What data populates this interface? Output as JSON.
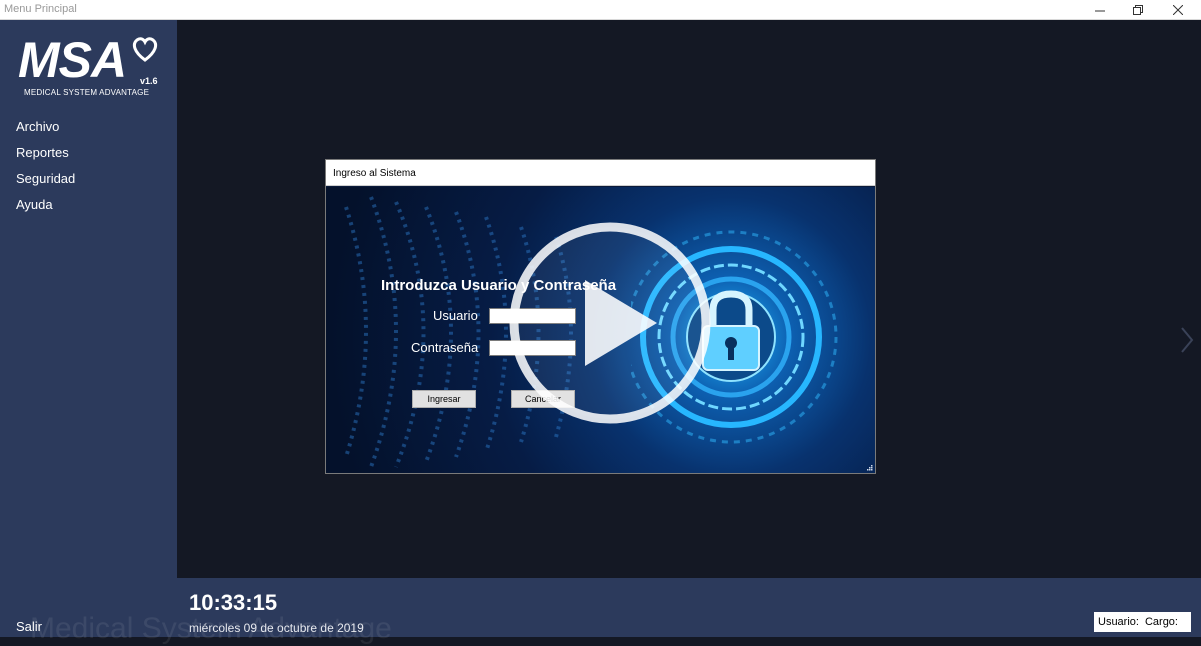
{
  "window": {
    "title": "Menu Principal"
  },
  "sidebar": {
    "logo_text": "MSA",
    "logo_version": "v1.6",
    "logo_subtitle": "MEDICAL SYSTEM ADVANTAGE",
    "items": [
      {
        "label": "Archivo"
      },
      {
        "label": "Reportes"
      },
      {
        "label": "Seguridad"
      },
      {
        "label": "Ayuda"
      }
    ],
    "exit_label": "Salir"
  },
  "dialog": {
    "title": "Ingreso al Sistema",
    "heading": "Introduzca Usuario y Contraseña",
    "user_label": "Usuario",
    "user_value": "",
    "password_label": "Contraseña",
    "password_value": "",
    "ok_label": "Ingresar",
    "cancel_label": "Cancelar"
  },
  "footer": {
    "time": "10:33:15",
    "date": "miércoles 09 de octubre de 2019",
    "user_label": "Usuario:",
    "role_label": "Cargo:",
    "watermark": "Medical System Advantage"
  },
  "colors": {
    "sidebar": "#2c3a5c",
    "main_bg": "#141824",
    "accent": "#1fb6ff"
  },
  "icons": [
    "minimize-icon",
    "restore-icon",
    "close-icon",
    "heart-logo-icon",
    "padlock-icon",
    "play-icon",
    "chevron-right-icon",
    "resize-grip-icon"
  ]
}
